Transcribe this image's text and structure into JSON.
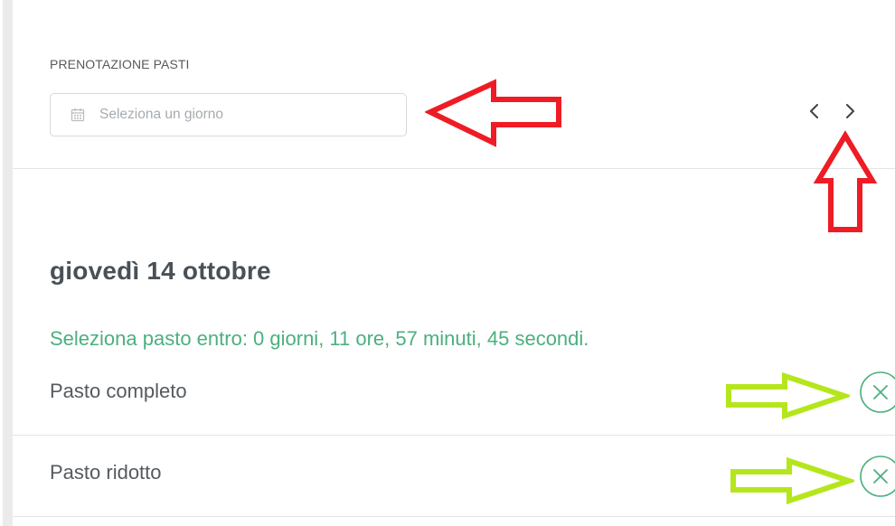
{
  "section_title": "PRENOTAZIONE PASTI",
  "date_picker": {
    "placeholder": "Seleziona un giorno",
    "value": ""
  },
  "day_heading": "giovedì 14 ottobre",
  "countdown_text": "Seleziona pasto entro: 0 giorni, 11 ore, 57 minuti, 45 secondi.",
  "meals": [
    {
      "label": "Pasto completo",
      "toggle_icon": "x-circle-icon"
    },
    {
      "label": "Pasto ridotto",
      "toggle_icon": "x-circle-icon"
    }
  ],
  "icons": {
    "calendar": "calendar-icon",
    "prev": "chevron-left-icon",
    "next": "chevron-right-icon"
  },
  "colors": {
    "accent_green": "#4caf7e",
    "annotation_red": "#ee1c24",
    "annotation_yellow_green": "#b5e61d"
  }
}
